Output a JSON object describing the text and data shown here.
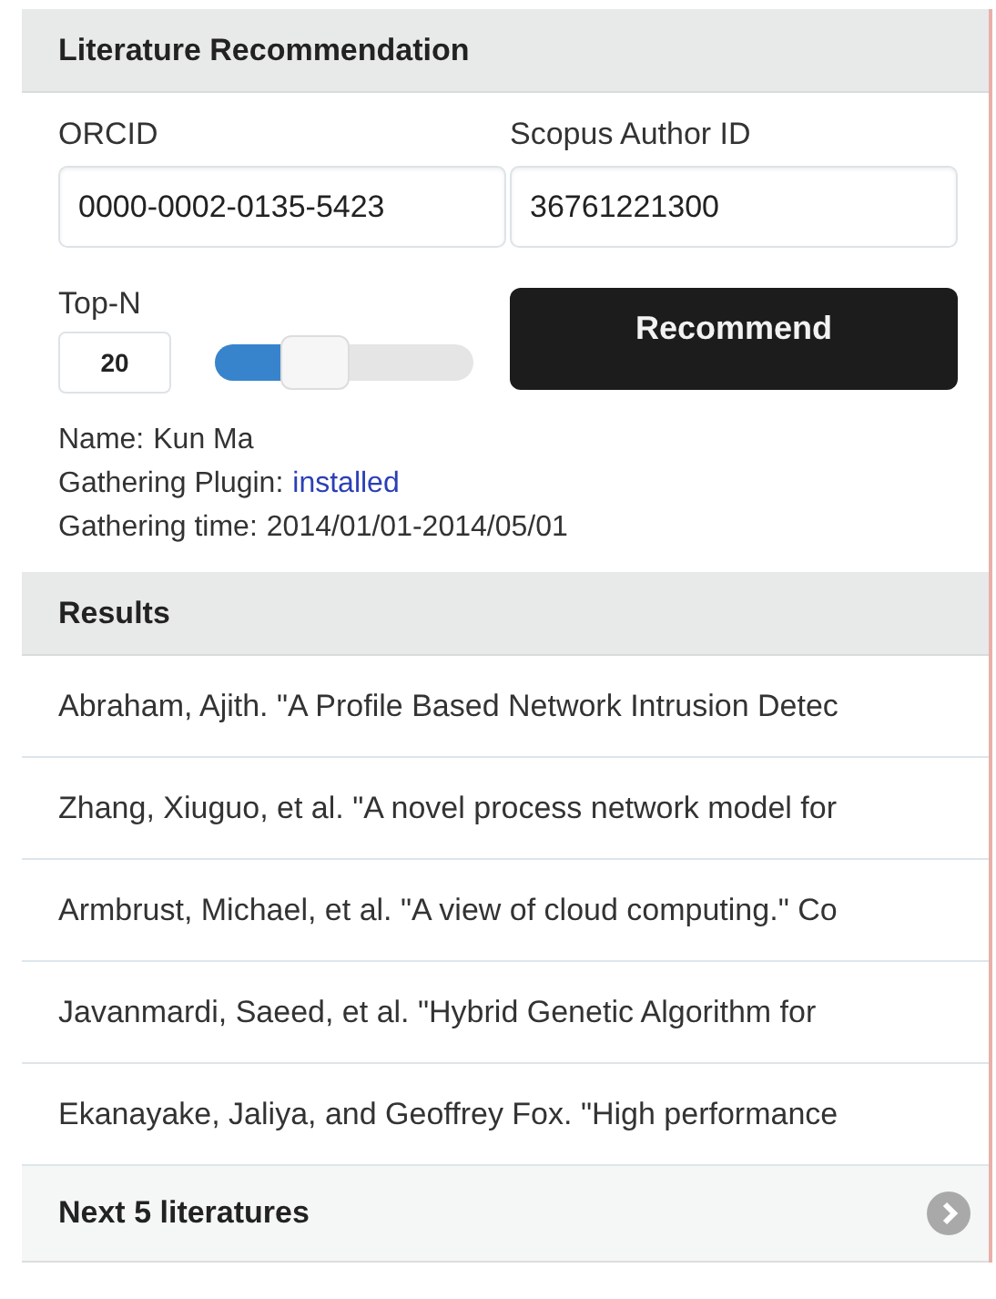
{
  "panel": {
    "title": "Literature Recommendation"
  },
  "form": {
    "orcid": {
      "label": "ORCID",
      "value": "0000-0002-0135-5423"
    },
    "scopus": {
      "label": "Scopus Author ID",
      "value": "36761221300"
    },
    "top_n": {
      "label": "Top-N",
      "value": "20",
      "level": 0.39
    },
    "recommend_button": "Recommend"
  },
  "info": [
    {
      "label": "Name:",
      "value": "Kun Ma",
      "kind": "text"
    },
    {
      "label": "Gathering Plugin:",
      "value": "installed",
      "kind": "link"
    },
    {
      "label": "Gathering time:",
      "value": "2014/01/01-2014/05/01",
      "kind": "text"
    }
  ],
  "results": {
    "title": "Results",
    "items": [
      "Abraham, Ajith. \"A Profile Based Network Intrusion Detec",
      "Zhang, Xiuguo, et al. \"A novel process network model for",
      "Armbrust, Michael, et al. \"A view of cloud computing.\" Co",
      "Javanmardi, Saeed, et al. \"Hybrid Genetic Algorithm for",
      "Ekanayake, Jaliya, and Geoffrey Fox. \"High performance"
    ],
    "next": "Next 5 literatures"
  }
}
